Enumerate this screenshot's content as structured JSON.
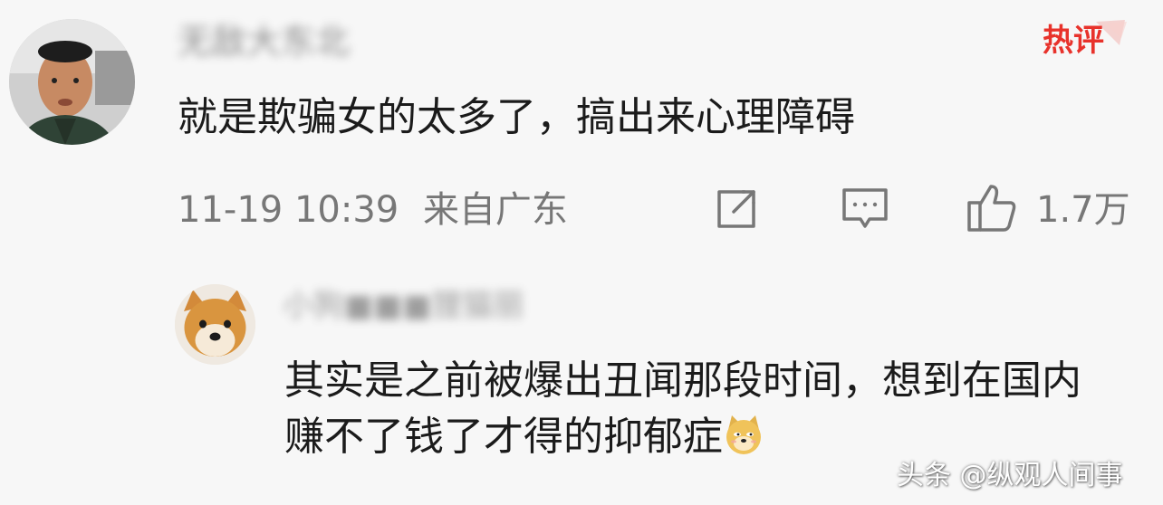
{
  "main_comment": {
    "username": "无敌大东北",
    "badge": "热评",
    "text": "就是欺骗女的太多了，搞出来心理障碍",
    "date": "11-19 10:39",
    "location": "来自广东",
    "likes": "1.7万",
    "icons": [
      "share-icon",
      "reply-icon",
      "like-icon"
    ]
  },
  "reply": {
    "username": "小狗■■■狸猫丽",
    "text": "其实是之前被爆出丑闻那段时间，想到在国内赚不了钱了才得的抑郁症",
    "emoji": "doge-emoji"
  },
  "watermark": "头条 @纵观人间事",
  "colors": {
    "hot_badge": "#e8322b",
    "meta_gray": "#777777",
    "background": "#f7f7f7"
  }
}
